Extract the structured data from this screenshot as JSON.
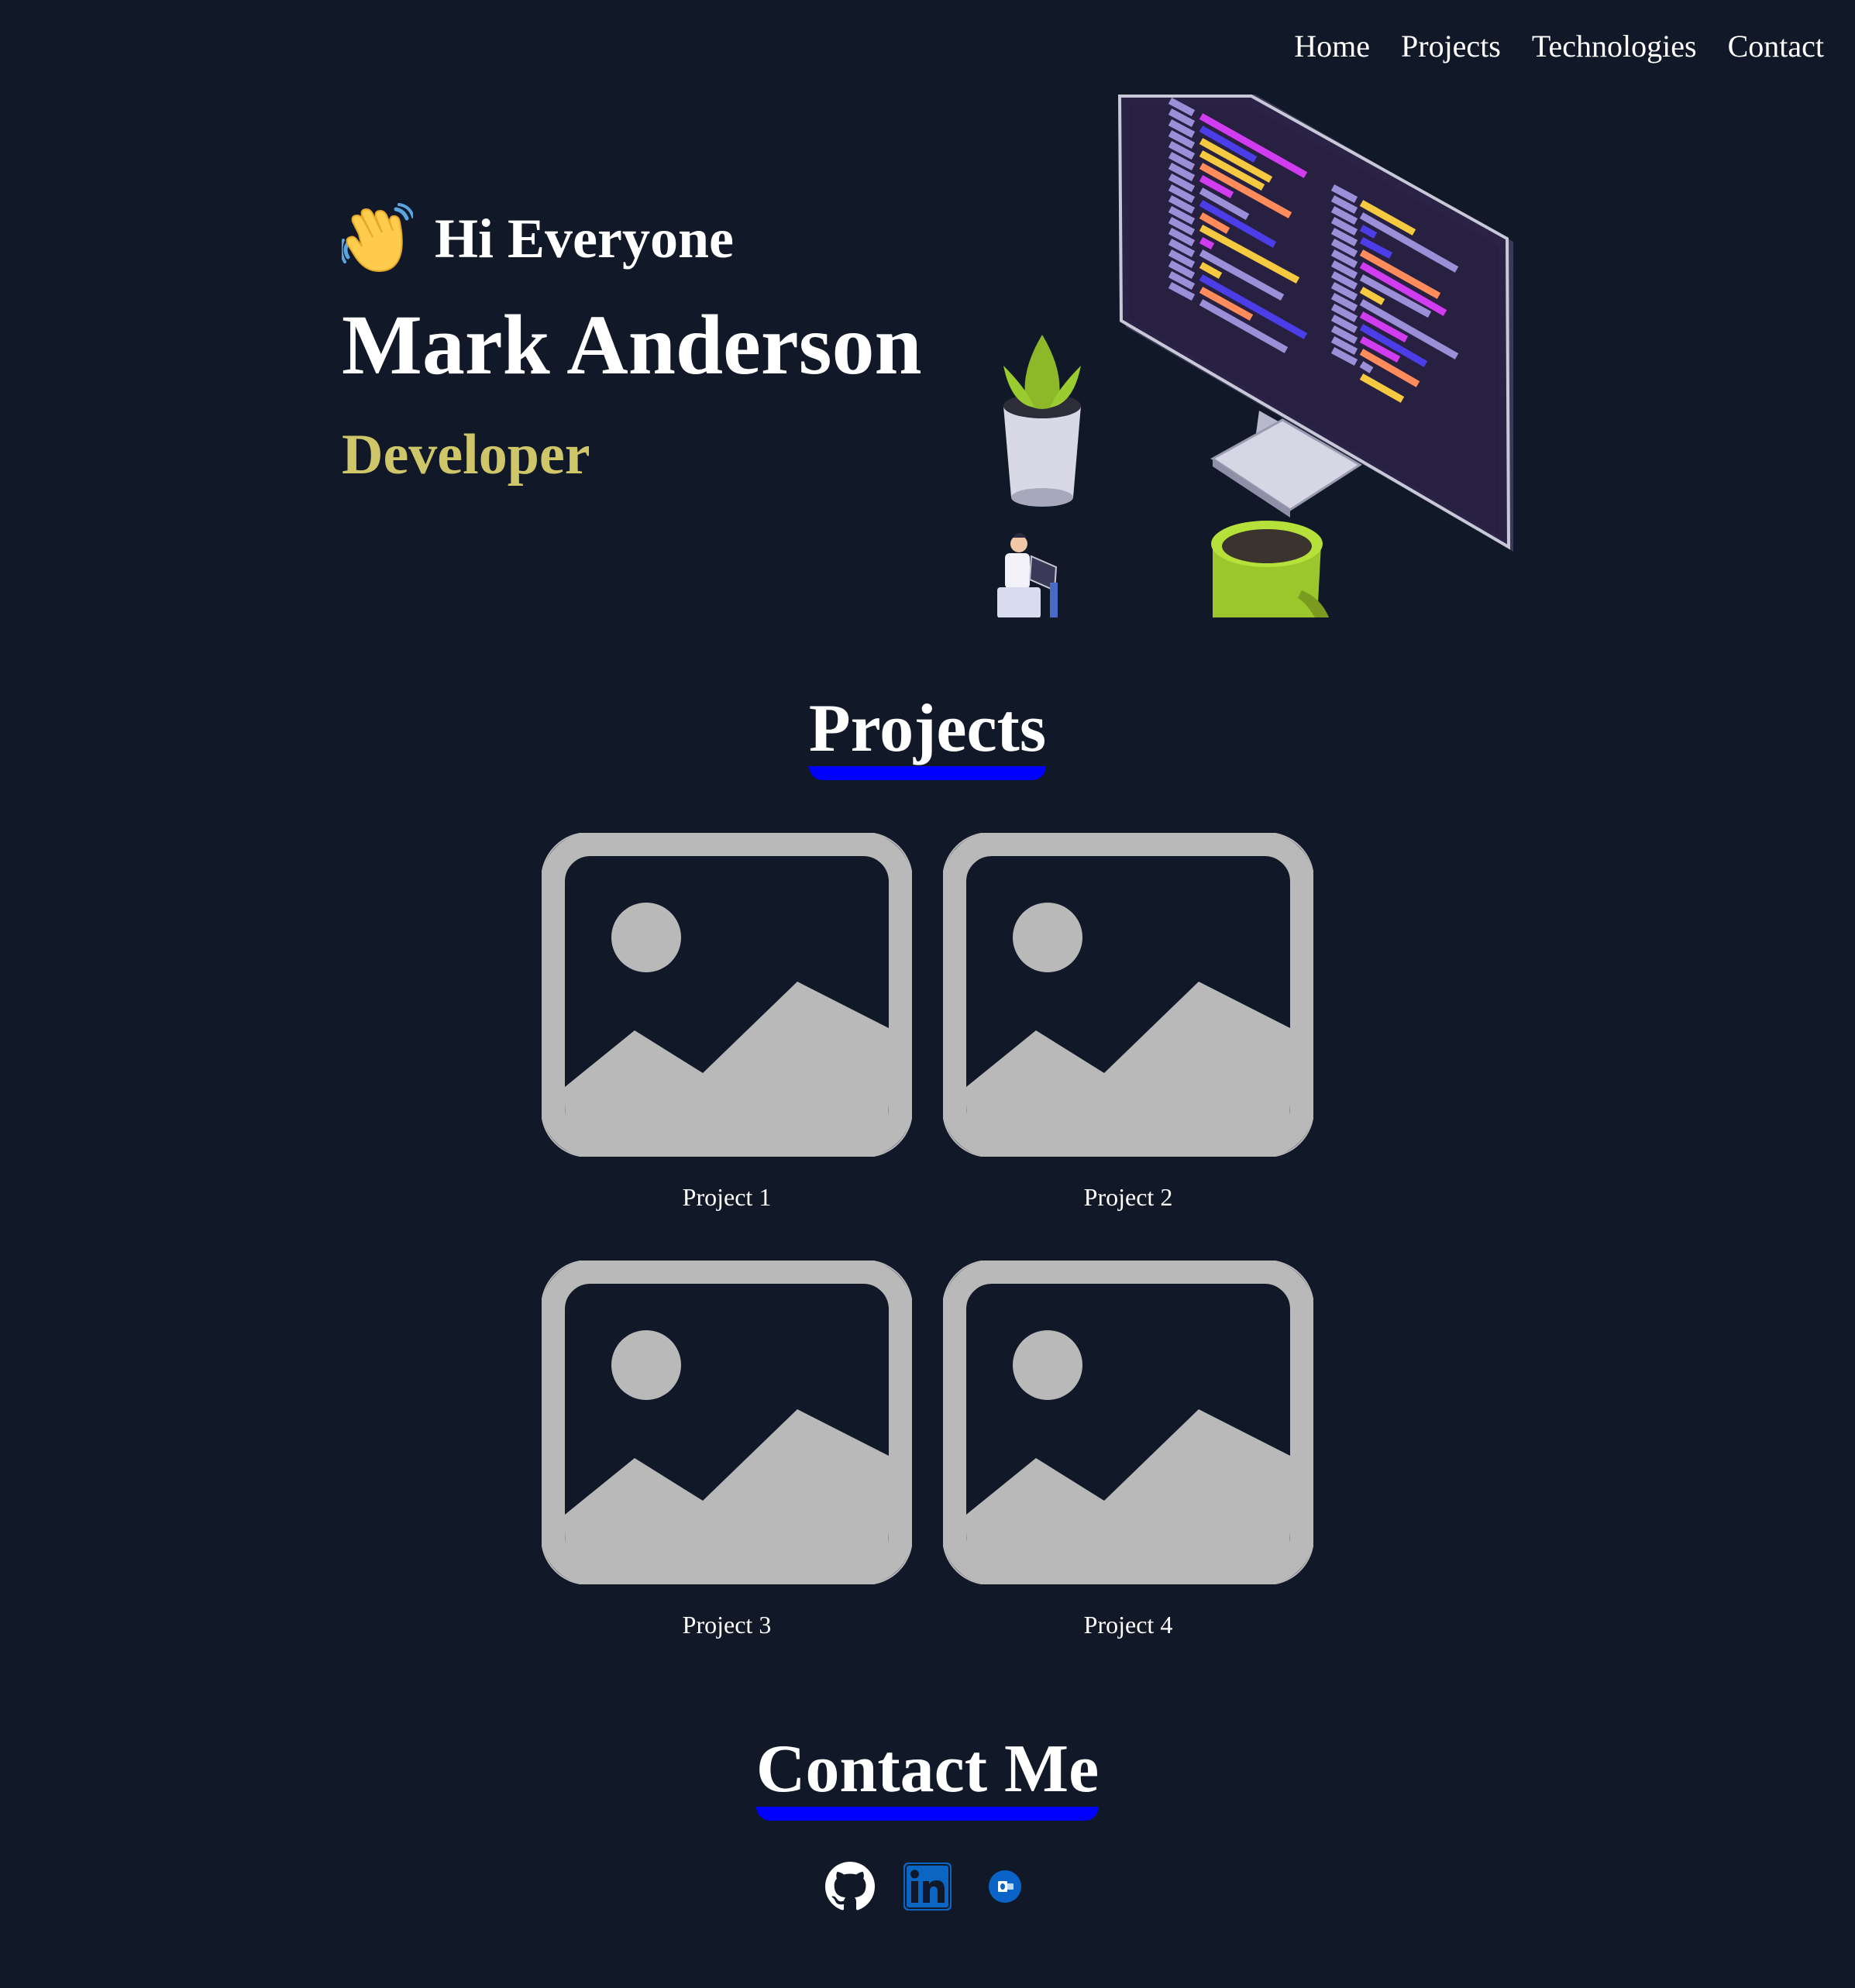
{
  "nav": {
    "items": [
      {
        "label": "Home"
      },
      {
        "label": "Projects"
      },
      {
        "label": "Technologies"
      },
      {
        "label": "Contact"
      }
    ]
  },
  "hero": {
    "greeting": "Hi Everyone",
    "greeting_icon": "waving-hand-icon",
    "name": "Mark Anderson",
    "role": "Developer",
    "role_color": "#cfc66a",
    "illustration": "developer-workspace-illustration"
  },
  "projects": {
    "title": "Projects",
    "items": [
      {
        "label": "Project 1",
        "icon": "image-placeholder-icon"
      },
      {
        "label": "Project 2",
        "icon": "image-placeholder-icon"
      },
      {
        "label": "Project 3",
        "icon": "image-placeholder-icon"
      },
      {
        "label": "Project 4",
        "icon": "image-placeholder-icon"
      }
    ]
  },
  "contact": {
    "title": "Contact Me",
    "links": [
      {
        "icon": "github-icon"
      },
      {
        "icon": "linkedin-icon"
      },
      {
        "icon": "outlook-icon"
      }
    ]
  },
  "colors": {
    "background": "#111827",
    "accent_underline": "#0000ff",
    "placeholder": "#b9b9b9",
    "role": "#cfc66a"
  }
}
